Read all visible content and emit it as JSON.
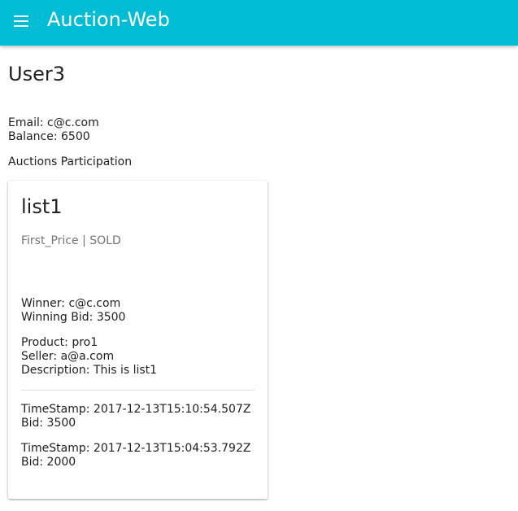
{
  "app": {
    "title": "Auction-Web"
  },
  "user": {
    "name": "User3",
    "email_line": "Email: c@c.com",
    "balance_line": "Balance: 6500"
  },
  "participation": {
    "heading": "Auctions Participation",
    "cards": [
      {
        "title": "list1",
        "subtitle": "First_Price | SOLD",
        "winner_line": "Winner: c@c.com",
        "winning_bid_line": "Winning Bid: 3500",
        "product_line": "Product: pro1",
        "seller_line": "Seller: a@a.com",
        "description_line": "Description: This is list1",
        "bids": [
          {
            "timestamp_line": "TimeStamp: 2017-12-13T15:10:54.507Z",
            "bid_line": "Bid: 3500"
          },
          {
            "timestamp_line": "TimeStamp: 2017-12-13T15:04:53.792Z",
            "bid_line": "Bid: 2000"
          }
        ]
      }
    ]
  },
  "colors": {
    "toolbar": "#00bcd4",
    "subtitle": "#757575"
  },
  "icons": {
    "menu": "menu-icon"
  }
}
